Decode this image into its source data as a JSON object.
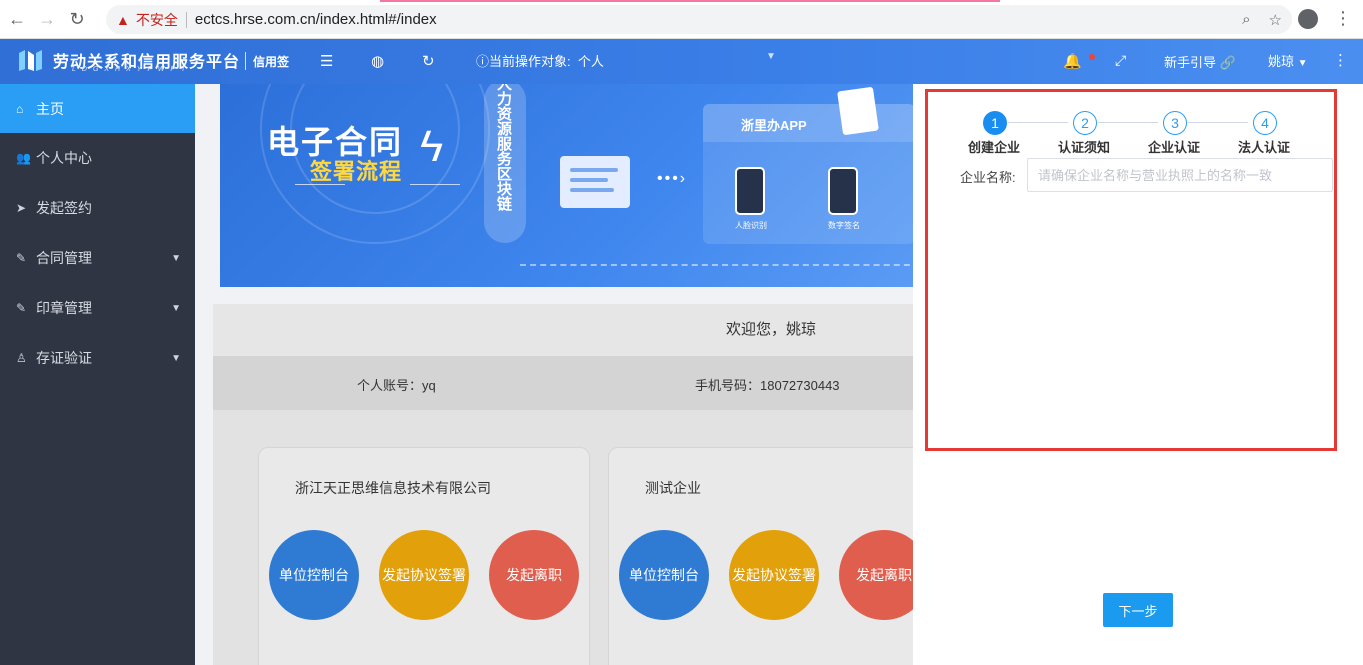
{
  "browser": {
    "insecure_label": "不安全",
    "url": "ectcs.hrse.com.cn/index.html#/index"
  },
  "header": {
    "app_title": "劳动关系和信用服务平台",
    "app_subtitle": "LDGXHXYFWPT",
    "app_tag": "信用签",
    "operate_label": "当前操作对象:",
    "operate_value": "个人",
    "guide_label": "新手引导",
    "user_name": "姚琼"
  },
  "sidebar": {
    "items": [
      {
        "label": "主页",
        "icon": "home-icon"
      },
      {
        "label": "个人中心",
        "icon": "users-icon"
      },
      {
        "label": "发起签约",
        "icon": "send-icon"
      },
      {
        "label": "合同管理",
        "icon": "contract-icon"
      },
      {
        "label": "印章管理",
        "icon": "seal-icon"
      },
      {
        "label": "存证验证",
        "icon": "user-icon"
      }
    ]
  },
  "banner": {
    "title1": "电子合同",
    "title2": "签署流程",
    "vertical_text": "人力资源服务区块链",
    "app_name": "浙里办APP",
    "label_face": "人脸识别",
    "label_sign": "数字签名"
  },
  "welcome": {
    "text": "欢迎您，姚琼",
    "account_label": "个人账号：yq",
    "phone_label": "手机号码：18072730443"
  },
  "companies": [
    {
      "name": "浙江天正思维信息技术有限公司",
      "buttons": [
        "单位控制台",
        "发起协议签署",
        "发起离职"
      ]
    },
    {
      "name": "测试企业",
      "buttons": [
        "单位控制台",
        "发起协议签署",
        "发起离职"
      ]
    }
  ],
  "panel": {
    "steps": [
      {
        "num": "1",
        "label": "创建企业"
      },
      {
        "num": "2",
        "label": "认证须知"
      },
      {
        "num": "3",
        "label": "企业认证"
      },
      {
        "num": "4",
        "label": "法人认证"
      }
    ],
    "field_label": "企业名称:",
    "field_placeholder": "请确保企业名称与营业执照上的名称一致",
    "next_label": "下一步"
  },
  "colors": {
    "accent": "#2a9df4",
    "sidebar_bg": "#2f3542",
    "header_bg": "#3b7fe8",
    "frame_red": "#e53935"
  }
}
